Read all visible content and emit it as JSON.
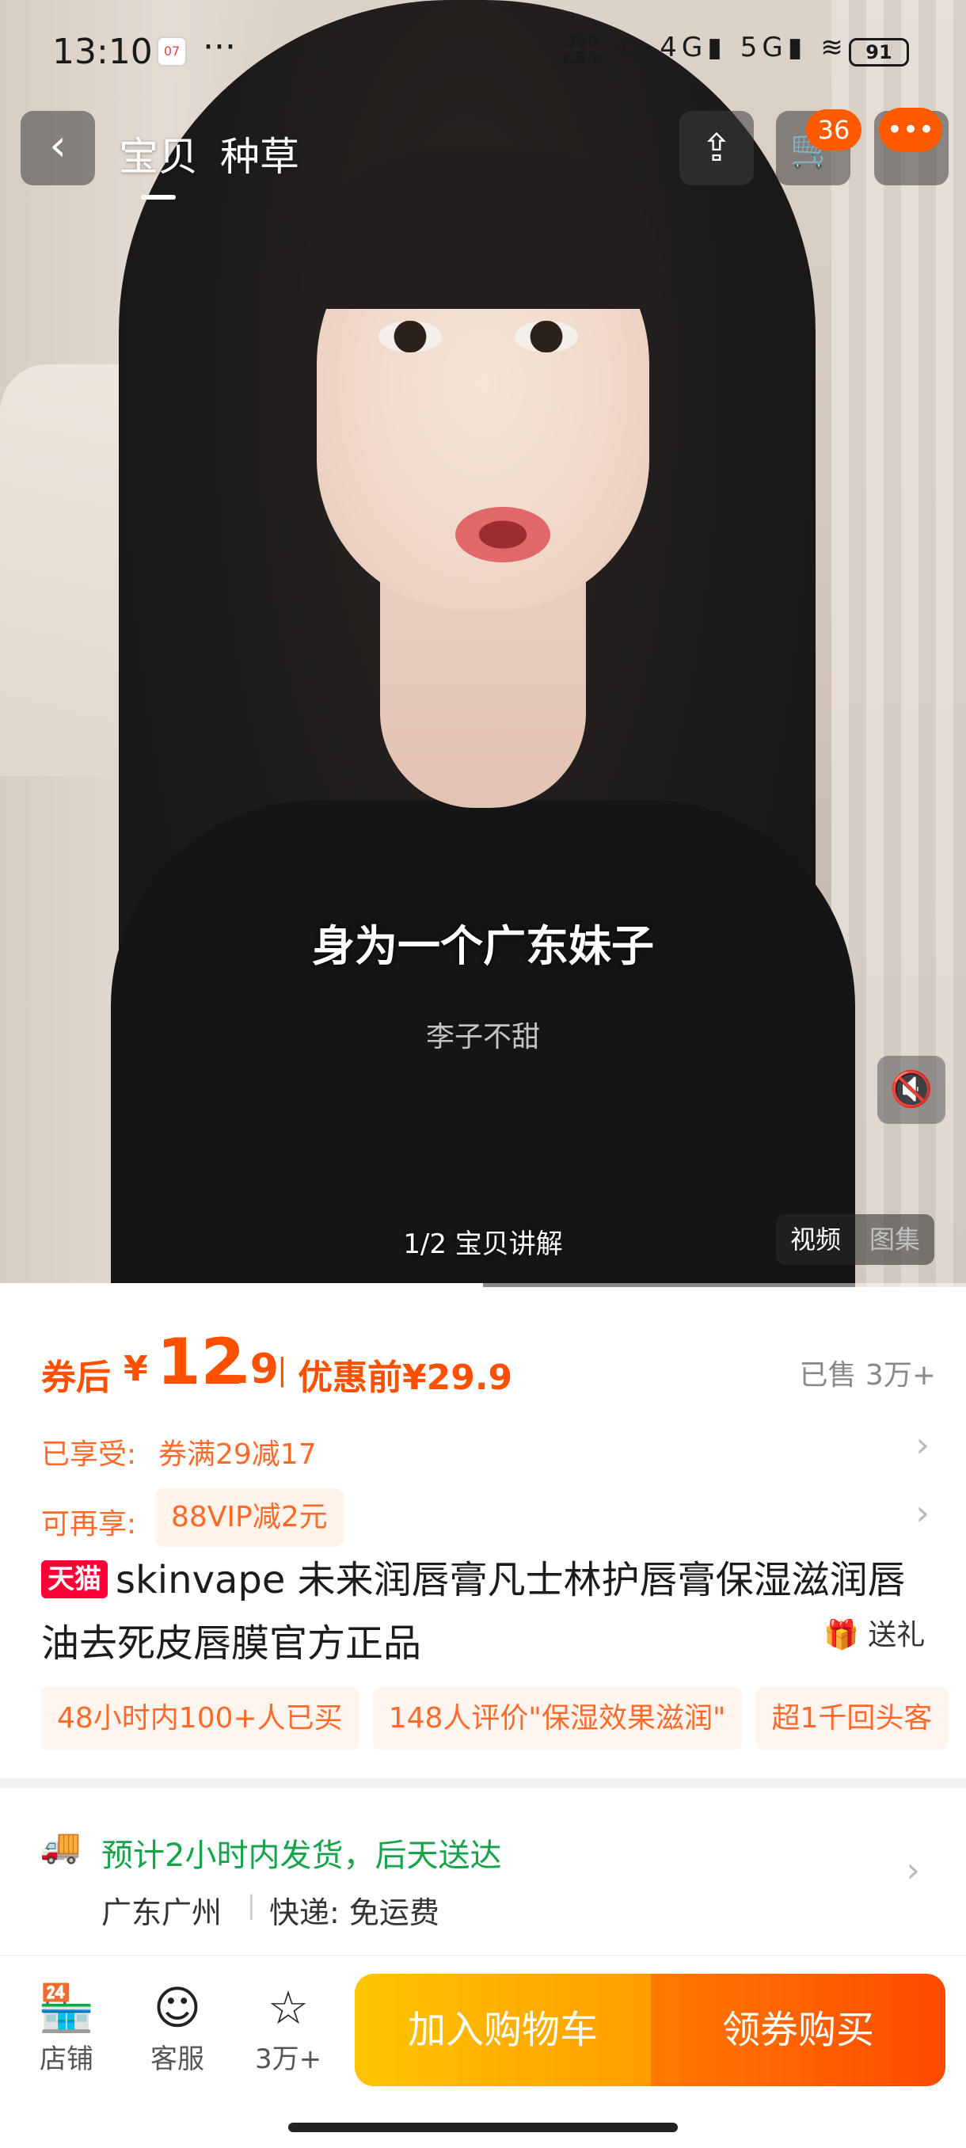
{
  "status_bar": {
    "time": "13:10",
    "notif_day": "07",
    "more": "···",
    "net_speed_value": "350",
    "net_speed_unit": "KB/s",
    "sys_icons": "☾ 4G▮ 5G▮ ≋",
    "battery": "91"
  },
  "nav": {
    "back_icon": "‹",
    "tabs": [
      "宝贝",
      "种草"
    ],
    "share_icon": "⇪",
    "cart_icon": "🛒",
    "cart_count": "36",
    "message_icon": "•••"
  },
  "video": {
    "subtitle": "身为一个广东妹子",
    "watermark": "李子不甜",
    "mute_icon": "🔇",
    "caption": "1/2 宝贝讲解",
    "toggle": [
      "视频",
      "图集"
    ],
    "progress": 0.5
  },
  "price": {
    "label": "券后",
    "symbol": "¥",
    "integer": "12",
    "decimal": ".9",
    "separator": "|",
    "before": "优惠前¥29.9",
    "sold": "已售 3万+"
  },
  "promos": [
    {
      "label": "已享受:",
      "value": "券满29减17"
    },
    {
      "label": "可再享:",
      "value": "88VIP减2元"
    }
  ],
  "product": {
    "badge": "天猫",
    "title": "skinvape 未来润唇膏凡士林护唇膏保湿滋润唇油去死皮唇膜官方正品",
    "gift_icon": "🎁",
    "gift_label": "送礼",
    "tags": [
      "48小时内100+人已买",
      "148人评价\"保湿效果滋润\"",
      "超1千回头客"
    ]
  },
  "shipping": {
    "icon": "🚚",
    "eta": "预计2小时内发货，后天送达",
    "from": "广东广州",
    "sep": "|",
    "express": "快递: 免运费"
  },
  "bottom_bar": {
    "shop_icon": "🏪",
    "shop_label": "店铺",
    "service_icon": "☺",
    "service_label": "客服",
    "fav_icon": "☆",
    "fav_label": "3万+",
    "add_cart": "加入购物车",
    "buy": "领券购买"
  },
  "colors": {
    "accent": "#ff5000",
    "tmall_red": "#ff0036",
    "ship_green": "#16a34a"
  }
}
